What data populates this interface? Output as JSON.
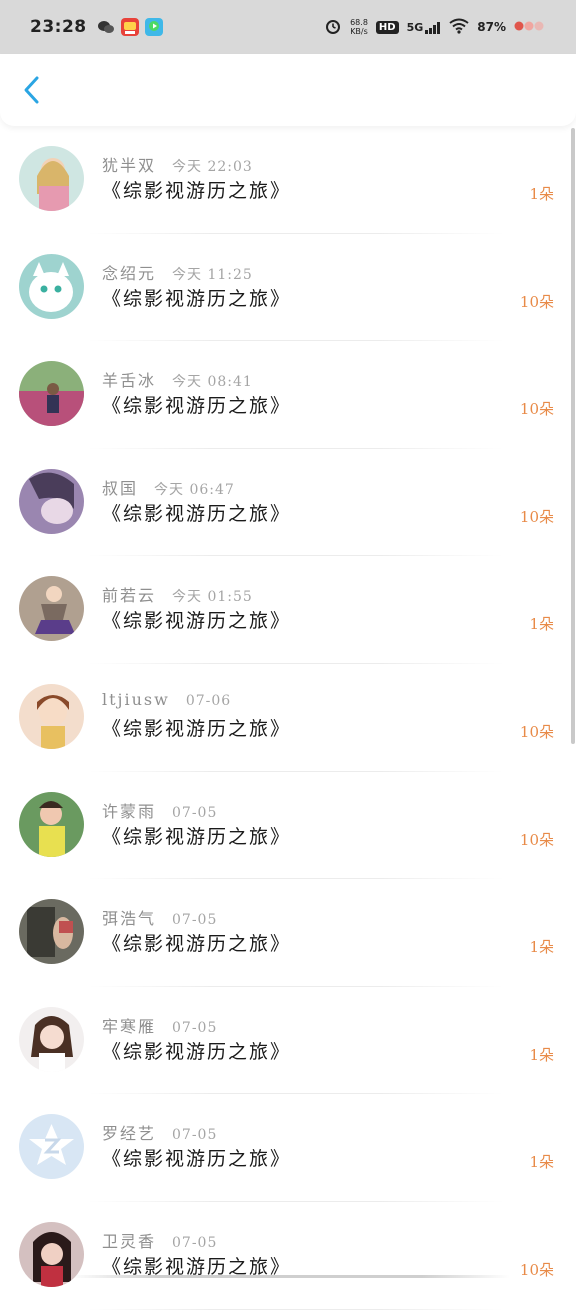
{
  "status_bar": {
    "time": "23:28",
    "net_speed_value": "68.8",
    "net_speed_unit": "KB/s",
    "hd": "HD",
    "network": "5G",
    "battery": "87%"
  },
  "header": {
    "back_icon": "chevron-left-icon",
    "accent_color": "#2aa5e3"
  },
  "colors": {
    "amount": "#e88a47",
    "name": "#8f8f8f",
    "title": "#1a1a1a"
  },
  "items": [
    {
      "name": "犹半双",
      "time": "今天 22:03",
      "title": "《综影视游历之旅》",
      "amount": "1朵"
    },
    {
      "name": "念绍元",
      "time": "今天 11:25",
      "title": "《综影视游历之旅》",
      "amount": "10朵"
    },
    {
      "name": "羊舌冰",
      "time": "今天 08:41",
      "title": "《综影视游历之旅》",
      "amount": "10朵"
    },
    {
      "name": "叔国",
      "time": "今天 06:47",
      "title": "《综影视游历之旅》",
      "amount": "10朵"
    },
    {
      "name": "前若云",
      "time": "今天 01:55",
      "title": "《综影视游历之旅》",
      "amount": "1朵"
    },
    {
      "name": "ltjiusw",
      "time": "07-06",
      "title": "《综影视游历之旅》",
      "amount": "10朵"
    },
    {
      "name": "许蒙雨",
      "time": "07-05",
      "title": "《综影视游历之旅》",
      "amount": "10朵"
    },
    {
      "name": "弭浩气",
      "time": "07-05",
      "title": "《综影视游历之旅》",
      "amount": "1朵"
    },
    {
      "name": "牢寒雁",
      "time": "07-05",
      "title": "《综影视游历之旅》",
      "amount": "1朵"
    },
    {
      "name": "罗经艺",
      "time": "07-05",
      "title": "《综影视游历之旅》",
      "amount": "1朵"
    },
    {
      "name": "卫灵香",
      "time": "07-05",
      "title": "《综影视游历之旅》",
      "amount": "10朵"
    }
  ]
}
